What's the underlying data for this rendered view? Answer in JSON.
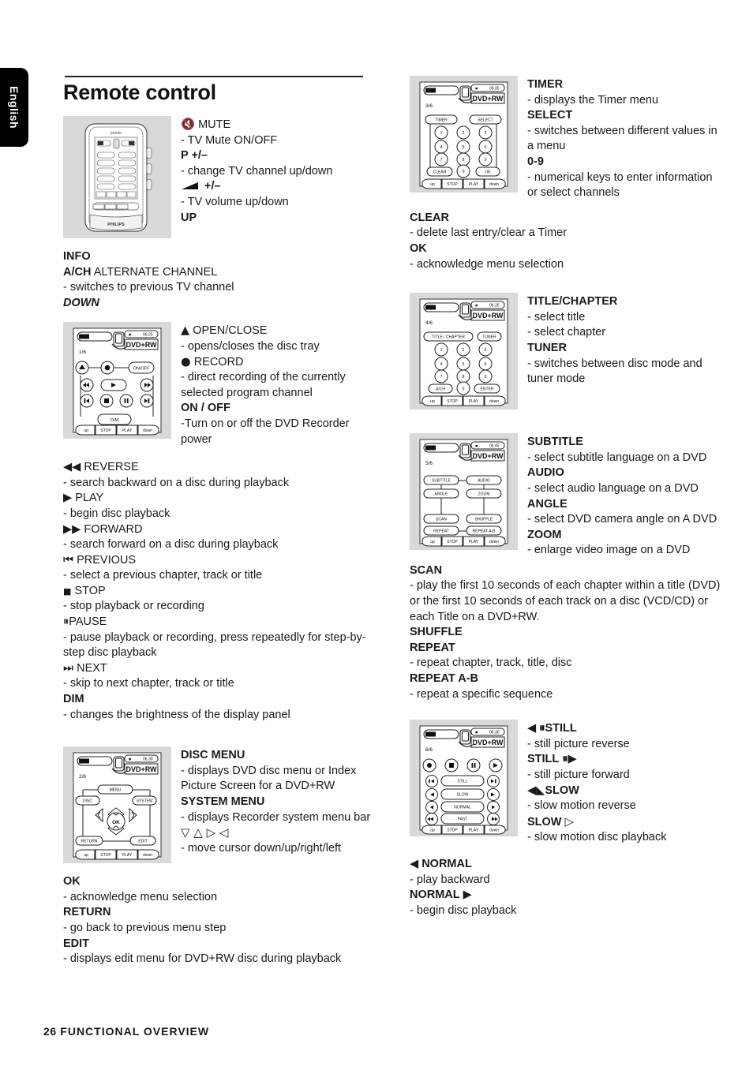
{
  "language_tab": "English",
  "page_title": "Remote control",
  "footer": {
    "page_number": "26",
    "section": "FUNCTIONAL OVERVIEW"
  },
  "left_column": {
    "fig1_entries": [
      {
        "icon": "mute-icon",
        "term": "MUTE",
        "term_style": "regular",
        "desc": "- TV Mute ON/OFF"
      },
      {
        "icon": "",
        "term": "P +/–",
        "term_style": "bold",
        "desc": "- change TV channel up/down"
      },
      {
        "icon": "volume-icon",
        "term": "+/–",
        "term_style": "bold",
        "desc": "- TV volume up/down"
      },
      {
        "icon": "",
        "term": "UP",
        "term_style": "bold",
        "desc": ""
      }
    ],
    "block_after_fig1": [
      {
        "term": "INFO",
        "term_style": "bold",
        "desc": ""
      },
      {
        "term": "A/CH",
        "term_suffix": "ALTERNATE CHANNEL",
        "term_style": "bold",
        "desc": "- switches to previous TV channel"
      },
      {
        "term": "DOWN",
        "term_style": "bold-italic",
        "desc": ""
      }
    ],
    "fig2_entries": [
      {
        "icon": "open-close-icon",
        "term": "OPEN/CLOSE",
        "term_style": "regular",
        "desc": "- opens/closes the disc tray"
      },
      {
        "icon": "record-icon",
        "term": "RECORD",
        "term_style": "regular",
        "desc": "- direct recording of the currently selected program channel"
      },
      {
        "icon": "",
        "term": "ON / OFF",
        "term_style": "bold",
        "desc": "-Turn on or off the DVD Recorder power"
      }
    ],
    "block_after_fig2": [
      {
        "icon": "reverse-icon",
        "term": "REVERSE",
        "term_style": "regular",
        "desc": "- search backward on a disc during playback"
      },
      {
        "icon": "play-icon",
        "term": "PLAY",
        "term_style": "regular",
        "desc": "- begin disc playback"
      },
      {
        "icon": "forward-icon",
        "term": "FORWARD",
        "term_style": "regular",
        "desc": "- search forward on a disc during playback"
      },
      {
        "icon": "previous-icon",
        "term": "PREVIOUS",
        "term_style": "regular",
        "desc": "- select a previous chapter, track or title"
      },
      {
        "icon": "stop-icon",
        "term": "STOP",
        "term_style": "regular",
        "desc": "- stop playback or recording"
      },
      {
        "icon": "pause-icon",
        "term": "PAUSE",
        "term_style": "regular",
        "desc": "- pause playback or recording, press repeatedly for step-by-step disc playback"
      },
      {
        "icon": "next-icon",
        "term": "NEXT",
        "term_style": "regular",
        "desc": "- skip to next chapter, track or title"
      },
      {
        "icon": "",
        "term": "DIM",
        "term_style": "bold",
        "desc": "- changes the brightness of the display panel"
      }
    ],
    "fig3_entries": [
      {
        "icon": "",
        "term": "DISC MENU",
        "term_style": "bold",
        "desc": "- displays DVD disc menu or Index Picture Screen for a DVD+RW"
      },
      {
        "icon": "",
        "term": "SYSTEM MENU",
        "term_style": "bold",
        "desc": "- displays Recorder system menu bar"
      },
      {
        "icon": "cursor-arrows-icon",
        "term": "▽ △ ▷ ◁",
        "term_style": "hollow",
        "desc": "- move cursor down/up/right/left"
      }
    ],
    "block_after_fig3": [
      {
        "term": "OK",
        "term_style": "bold",
        "desc": "- acknowledge menu selection"
      },
      {
        "term": "RETURN",
        "term_style": "bold",
        "desc": "- go back to previous menu step"
      },
      {
        "term": "EDIT",
        "term_style": "bold",
        "desc": "- displays edit menu for DVD+RW disc during playback"
      }
    ]
  },
  "right_column": {
    "fig4_entries": [
      {
        "term": "TIMER",
        "term_style": "bold",
        "desc": "- displays the Timer menu"
      },
      {
        "term": "SELECT",
        "term_style": "bold",
        "desc": "- switches between different values in a menu"
      },
      {
        "term": "0-9",
        "term_style": "bold",
        "desc": "- numerical keys to enter information or select channels"
      }
    ],
    "block_after_fig4": [
      {
        "term": "CLEAR",
        "term_style": "bold",
        "desc": "- delete last entry/clear a Timer"
      },
      {
        "term": "OK",
        "term_style": "bold",
        "desc": "- acknowledge menu selection"
      }
    ],
    "fig5_entries": [
      {
        "term": "TITLE/CHAPTER",
        "term_style": "bold",
        "desc": "- select title\n- select chapter"
      },
      {
        "term": "TUNER",
        "term_style": "bold",
        "desc": "- switches between disc mode and tuner mode"
      }
    ],
    "fig6_entries": [
      {
        "term": "SUBTITLE",
        "term_style": "bold",
        "desc": "- select subtitle language on a DVD"
      },
      {
        "term": "AUDIO",
        "term_style": "bold",
        "desc": "- select audio language on a DVD"
      },
      {
        "term": "ANGLE",
        "term_style": "bold",
        "desc": "- select DVD camera angle on A DVD"
      },
      {
        "term": "ZOOM",
        "term_style": "bold",
        "desc": "- enlarge video image on a DVD"
      }
    ],
    "block_after_fig6": [
      {
        "term": "SCAN",
        "term_style": "bold",
        "desc": "- play the first 10 seconds of each chapter within a title (DVD) or the first 10 seconds of each track on a disc (VCD/CD) or each Title on a DVD+RW."
      },
      {
        "term": "SHUFFLE",
        "term_style": "bold",
        "desc": ""
      },
      {
        "term": "REPEAT",
        "term_style": "bold",
        "desc": "- repeat chapter, track, title, disc"
      },
      {
        "term": "REPEAT A-B",
        "term_style": "bold",
        "desc": "- repeat a specific sequence"
      }
    ],
    "fig7_entries": [
      {
        "icon": "still-reverse-icon",
        "term": "STILL",
        "term_style": "bold",
        "desc": "- still picture reverse"
      },
      {
        "icon": "still-forward-icon",
        "term": "STILL",
        "term_style": "bold",
        "desc": "- still picture forward"
      },
      {
        "icon": "slow-reverse-icon",
        "term": "SLOW",
        "term_style": "bold",
        "desc": "- slow motion reverse"
      },
      {
        "icon": "slow-forward-icon",
        "term": "SLOW",
        "term_style": "bold",
        "desc": "- slow motion disc playback"
      }
    ],
    "block_after_fig7": [
      {
        "icon": "normal-reverse-icon",
        "term": "NORMAL",
        "term_style": "bold",
        "desc": "- play backward"
      },
      {
        "icon": "normal-forward-icon",
        "term": "NORMAL",
        "term_style": "bold",
        "desc": "- begin disc playback"
      }
    ]
  },
  "figures": {
    "remote_photo": {
      "brand": "PHILIPS",
      "sub_brand": "pronto"
    },
    "lcd1": {
      "page": "1/6",
      "disc": "DVD+RW",
      "time": "06:25",
      "buttons": [
        "ON/OFF",
        "DIM"
      ],
      "footer": [
        "up",
        "STOP",
        "PLAY",
        "down"
      ]
    },
    "lcd2": {
      "page": "2/6",
      "disc": "DVD+RW",
      "time": "06:30",
      "buttons": [
        "MENU",
        "DISC",
        "SYSTEM",
        "OK",
        "RETURN",
        "EDIT"
      ],
      "footer": [
        "up",
        "STOP",
        "PLAY",
        "down"
      ]
    },
    "lcd3": {
      "page": "3/6",
      "disc": "DVD+RW",
      "time": "06:30",
      "buttons": [
        "TIMER",
        "SELECT",
        "1",
        "2",
        "3",
        "4",
        "5",
        "6",
        "7",
        "8",
        "9",
        "CLEAR",
        "0",
        "OK"
      ],
      "footer": [
        "up",
        "STOP",
        "PLAY",
        "down"
      ]
    },
    "lcd4": {
      "page": "4/6",
      "disc": "DVD+RW",
      "time": "06:30",
      "buttons": [
        "TITLE / CHAPTER",
        "TUNER",
        "1",
        "2",
        "3",
        "4",
        "5",
        "6",
        "7",
        "8",
        "9",
        "A/CH",
        "0",
        "ENTER"
      ],
      "footer": [
        "up",
        "STOP",
        "PLAY",
        "down"
      ]
    },
    "lcd5": {
      "page": "5/6",
      "disc": "DVD+RW",
      "time": "06:45",
      "buttons": [
        "SUBTITLE",
        "AUDIO",
        "ANGLE",
        "ZOOM",
        "SCAN",
        "SHUFFLE",
        "REPEAT",
        "REPEAT A-B"
      ],
      "footer": [
        "up",
        "STOP",
        "PLAY",
        "down"
      ]
    },
    "lcd6": {
      "page": "6/6",
      "disc": "DVD+RW",
      "time": "06:30",
      "buttons": [
        "STILL",
        "SLOW",
        "NORMAL",
        "FAST"
      ],
      "footer": [
        "up",
        "STOP",
        "PLAY",
        "down"
      ]
    }
  }
}
